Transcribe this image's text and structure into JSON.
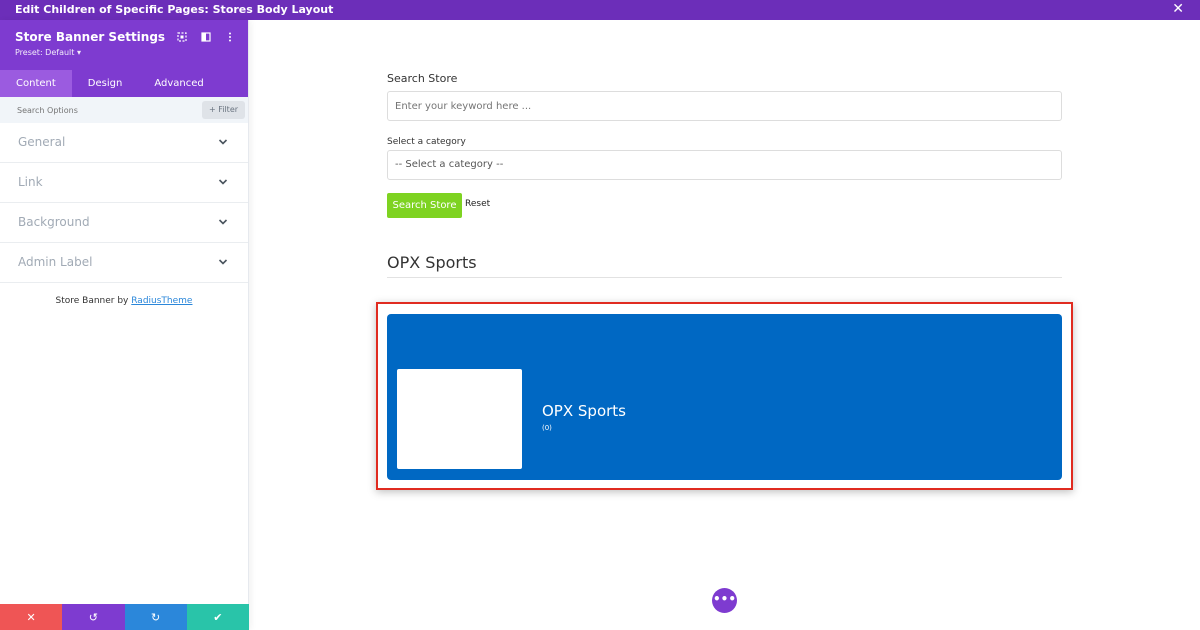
{
  "topbar": {
    "title": "Edit Children of Specific Pages: Stores Body Layout",
    "close_glyph": "✕"
  },
  "sidebar": {
    "title": "Store Banner Settings",
    "preset": "Preset: Default ▾",
    "tabs": [
      {
        "label": "Content"
      },
      {
        "label": "Design"
      },
      {
        "label": "Advanced"
      }
    ],
    "search_placeholder": "Search Options",
    "filter_label": "+ Filter",
    "sections": [
      {
        "label": "General"
      },
      {
        "label": "Link"
      },
      {
        "label": "Background"
      },
      {
        "label": "Admin Label"
      }
    ],
    "credit_prefix": "Store Banner by ",
    "credit_link": "RadiusTheme",
    "bottom": {
      "close": "✕",
      "undo": "↺",
      "redo": "↻",
      "save": "✔"
    }
  },
  "main": {
    "search_label": "Search Store",
    "keyword_placeholder": "Enter your keyword here ...",
    "category_label": "Select a category",
    "category_value": "-- Select a category --",
    "search_button": "Search Store",
    "reset_button": "Reset",
    "store_heading": "OPX Sports",
    "banner": {
      "name": "OPX Sports",
      "count": "(0)"
    },
    "fab_glyph": "•••"
  },
  "colors": {
    "purple": "#7e3bd0",
    "topbar": "#6c2eb9",
    "banner": "#0068c3",
    "green": "#7ed321",
    "highlight": "#e02b20"
  }
}
